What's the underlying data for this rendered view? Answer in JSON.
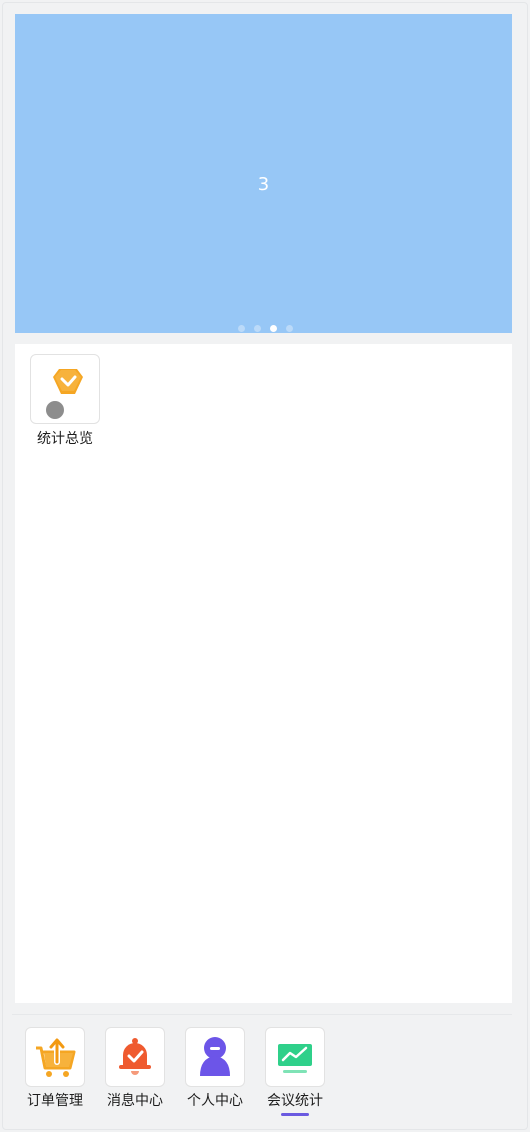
{
  "carousel": {
    "current_slide": "3",
    "dot_count": 4,
    "active_dot": 3
  },
  "grid": {
    "items": [
      {
        "label": "统计总览",
        "icon": "diamond-badge-icon"
      }
    ]
  },
  "tabbar": {
    "items": [
      {
        "label": "订单管理",
        "icon": "cart-upload-icon"
      },
      {
        "label": "消息中心",
        "icon": "bell-check-icon"
      },
      {
        "label": "个人中心",
        "icon": "person-icon"
      },
      {
        "label": "会议统计",
        "icon": "monitor-chart-icon",
        "active": true
      }
    ]
  },
  "colors": {
    "carousel_bg": "#97c7f6",
    "indicator": "#6a5ae0",
    "orange": "#f5a623",
    "red": "#ef5a2f",
    "purple": "#6c55e8",
    "green": "#2fd08a"
  }
}
